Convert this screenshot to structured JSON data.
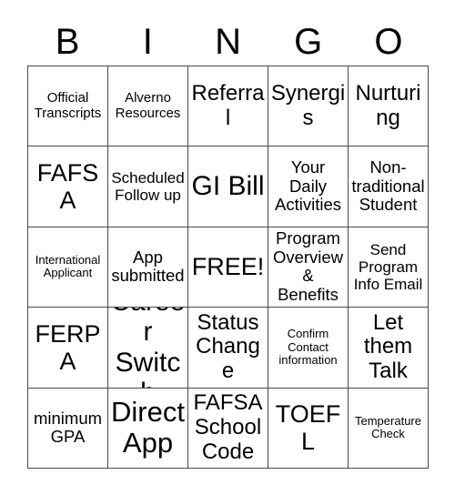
{
  "card": {
    "title": "BINGO",
    "header_letters": [
      "B",
      "I",
      "N",
      "G",
      "O"
    ],
    "free_space": "FREE!",
    "border_color": "#4a4a4a",
    "background_color": "#ffffff",
    "text_color": "#000000",
    "rows": 5,
    "columns": 5,
    "cells": [
      {
        "text": "Official Transcripts",
        "size": "fs-s"
      },
      {
        "text": "Alverno Resources",
        "size": "fs-s"
      },
      {
        "text": "Referral",
        "size": "fs-l"
      },
      {
        "text": "Synergis",
        "size": "fs-l"
      },
      {
        "text": "Nurturing",
        "size": "fs-l"
      },
      {
        "text": "FAFSA",
        "size": "fs-xl"
      },
      {
        "text": "Scheduled Follow up",
        "size": "fs-sm"
      },
      {
        "text": "GI Bill",
        "size": "fs-xxl"
      },
      {
        "text": "Your Daily Activities",
        "size": "fs-m"
      },
      {
        "text": "Non-traditional Student",
        "size": "fs-m"
      },
      {
        "text": "International Applicant",
        "size": "fs-xs"
      },
      {
        "text": "App submitted",
        "size": "fs-m"
      },
      {
        "text": "FREE!",
        "size": "fs-xl"
      },
      {
        "text": "Program Overview & Benefits",
        "size": "fs-m"
      },
      {
        "text": "Send Program Info Email",
        "size": "fs-sm"
      },
      {
        "text": "FERPA",
        "size": "fs-xl"
      },
      {
        "text": "Career Switch",
        "size": "fs-xxl"
      },
      {
        "text": "Status Change",
        "size": "fs-l"
      },
      {
        "text": "Confirm Contact information",
        "size": "fs-xs"
      },
      {
        "text": "Let them Talk",
        "size": "fs-l"
      },
      {
        "text": "minimum GPA",
        "size": "fs-m"
      },
      {
        "text": "Direct App",
        "size": "fs-h"
      },
      {
        "text": "FAFSA School Code",
        "size": "fs-l"
      },
      {
        "text": "TOEFL",
        "size": "fs-xl"
      },
      {
        "text": "Temperature Check",
        "size": "fs-xs"
      }
    ]
  }
}
